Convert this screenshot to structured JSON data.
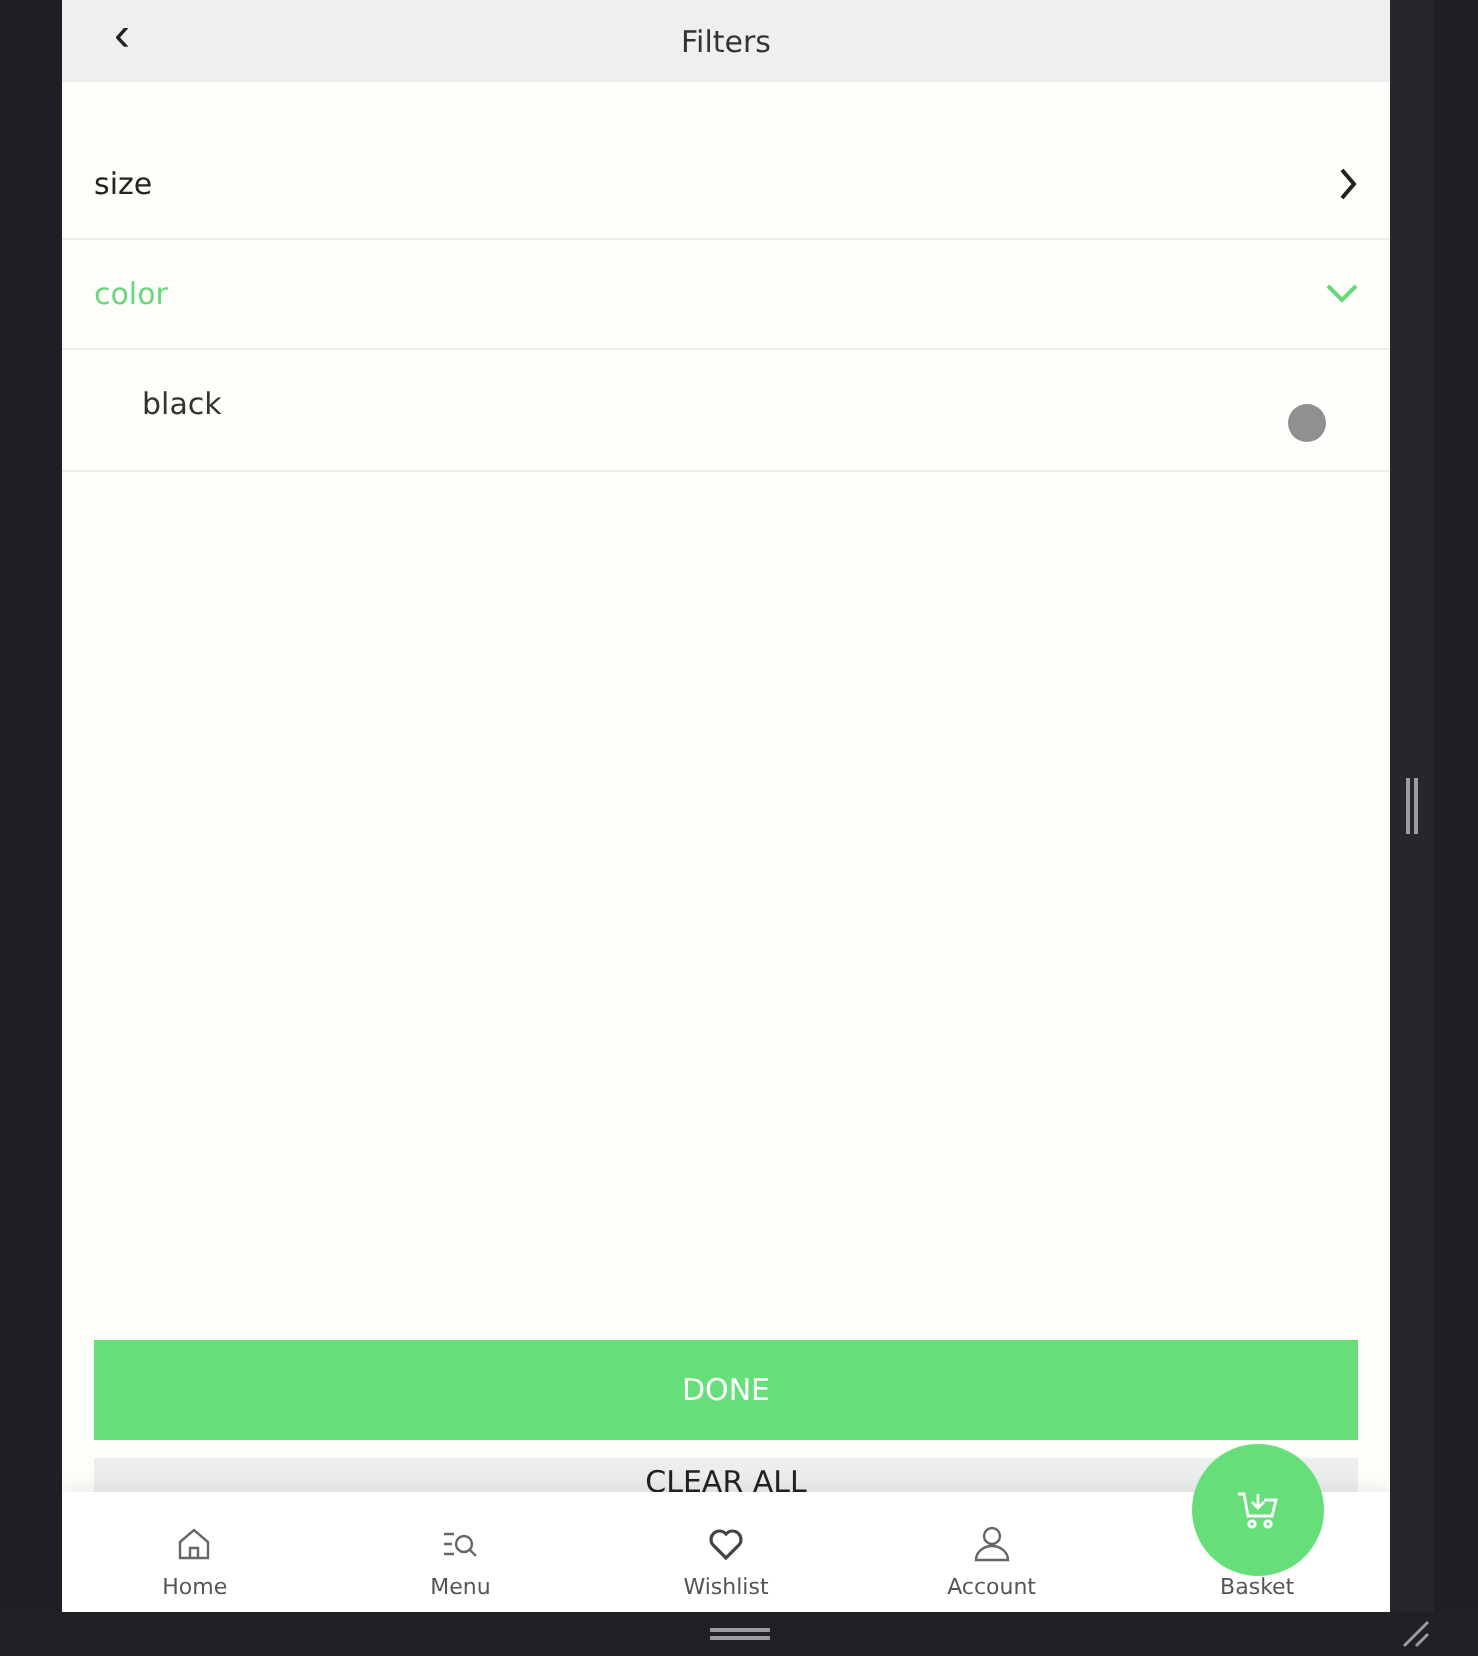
{
  "header": {
    "back": "‹",
    "title": "Filters"
  },
  "filters": [
    {
      "label": "size",
      "expanded": false
    },
    {
      "label": "color",
      "expanded": true,
      "children": [
        {
          "label": "black",
          "selected": false
        }
      ]
    }
  ],
  "buttons": {
    "done": "DONE",
    "clear": "CLEAR ALL"
  },
  "nav": [
    {
      "kind": "home",
      "label": "Home"
    },
    {
      "kind": "menu",
      "label": "Menu"
    },
    {
      "kind": "wishlist",
      "label": "Wishlist"
    },
    {
      "kind": "account",
      "label": "Account"
    },
    {
      "kind": "basket",
      "label": "Basket"
    }
  ]
}
